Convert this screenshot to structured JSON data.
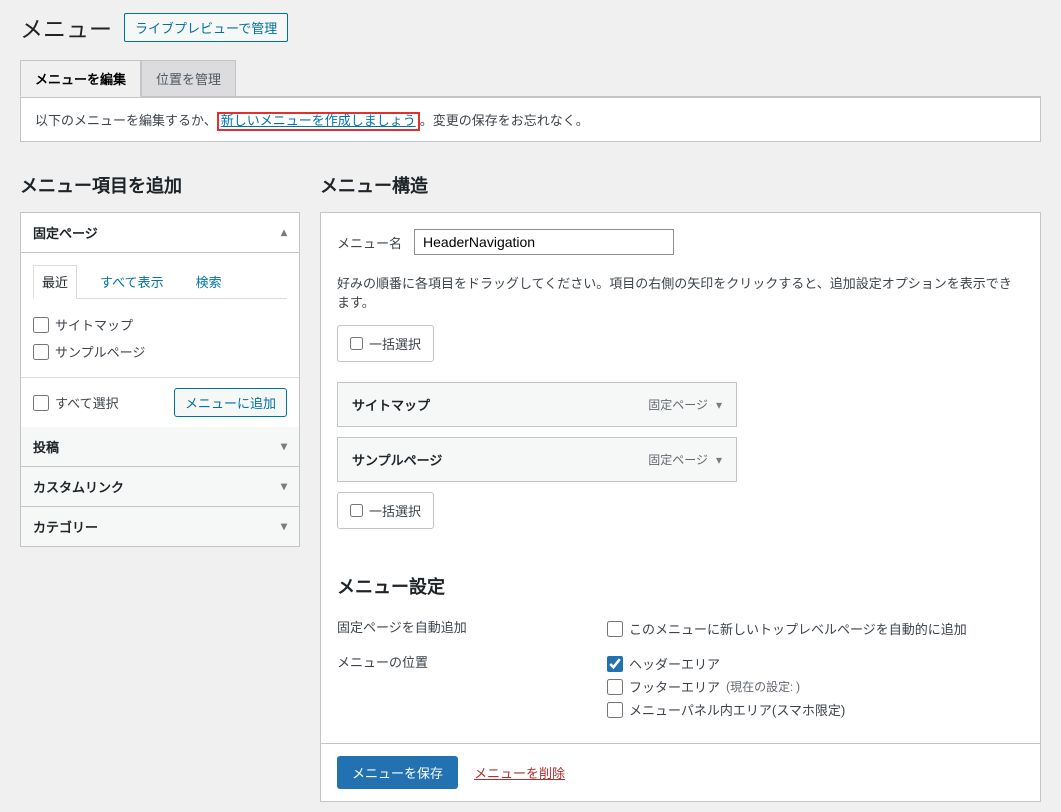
{
  "header": {
    "title": "メニュー",
    "live_preview_btn": "ライブプレビューで管理"
  },
  "tabs": {
    "edit": "メニューを編集",
    "locations": "位置を管理"
  },
  "notice": {
    "prefix": "以下のメニューを編集するか、",
    "link": "新しいメニューを作成しましょう",
    "suffix": "。変更の保存をお忘れなく。"
  },
  "left": {
    "title": "メニュー項目を追加",
    "pages": {
      "header": "固定ページ",
      "inner_tabs": {
        "recent": "最近",
        "all": "すべて表示",
        "search": "検索"
      },
      "items": [
        "サイトマップ",
        "サンプルページ"
      ],
      "select_all": "すべて選択",
      "add_btn": "メニューに追加"
    },
    "posts": "投稿",
    "custom_links": "カスタムリンク",
    "categories": "カテゴリー"
  },
  "right": {
    "title": "メニュー構造",
    "menu_name_label": "メニュー名",
    "menu_name_value": "HeaderNavigation",
    "help_text": "好みの順番に各項目をドラッグしてください。項目の右側の矢印をクリックすると、追加設定オプションを表示できます。",
    "bulk_select": "一括選択",
    "items": [
      {
        "title": "サイトマップ",
        "type": "固定ページ"
      },
      {
        "title": "サンプルページ",
        "type": "固定ページ"
      }
    ],
    "settings": {
      "title": "メニュー設定",
      "auto_add_label": "固定ページを自動追加",
      "auto_add_option": "このメニューに新しいトップレベルページを自動的に追加",
      "location_label": "メニューの位置",
      "locations": [
        {
          "label": "ヘッダーエリア",
          "checked": true,
          "note": ""
        },
        {
          "label": "フッターエリア",
          "checked": false,
          "note": "(現在の設定: )"
        },
        {
          "label": "メニューパネル内エリア(スマホ限定)",
          "checked": false,
          "note": ""
        }
      ]
    },
    "save_btn": "メニューを保存",
    "delete_link": "メニューを削除"
  }
}
